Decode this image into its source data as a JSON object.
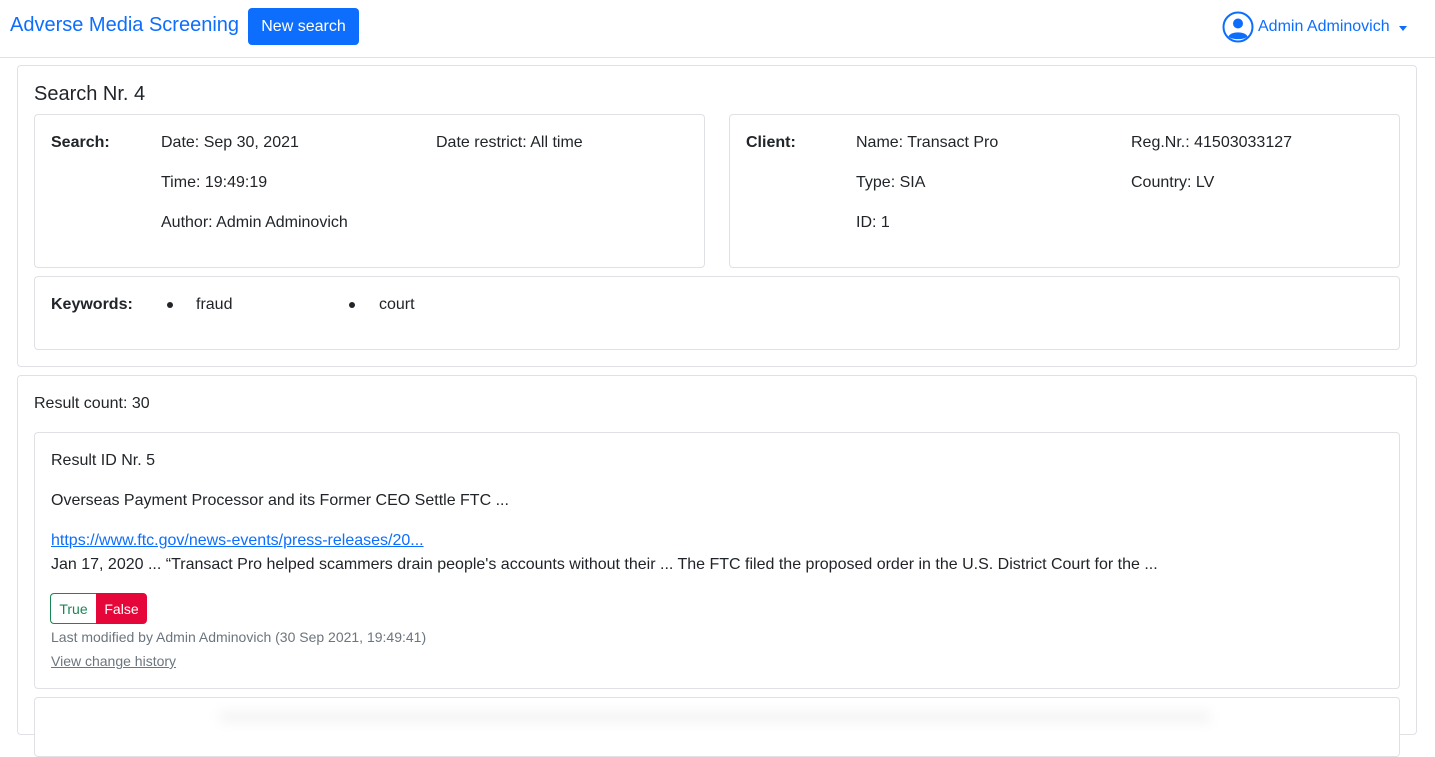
{
  "navbar": {
    "brand": "Adverse Media Screening",
    "new_search_label": "New search",
    "user_name": "Admin Adminovich",
    "user_icon": "user-circle-icon"
  },
  "search_card": {
    "title": "Search Nr. 4",
    "search": {
      "label": "Search:",
      "date": "Date: Sep 30, 2021",
      "time": "Time: 19:49:19",
      "author": "Author: Admin Adminovich",
      "date_restrict": "Date restrict: All time"
    },
    "client": {
      "label": "Client:",
      "name": "Name: Transact Pro",
      "type": "Type: SIA",
      "id": "ID: 1",
      "reg_nr": "Reg.Nr.: 41503033127",
      "country": "Country: LV"
    },
    "keywords": {
      "label": "Keywords:",
      "items": [
        "fraud",
        "court"
      ]
    }
  },
  "results": {
    "count_text": "Result count: 30",
    "items": [
      {
        "id_text": "Result ID Nr. 5",
        "title": "Overseas Payment Processor and its Former CEO Settle FTC ...",
        "url": "https://www.ftc.gov/news-events/press-releases/20...",
        "snippet": "Jan 17, 2020 ... “Transact Pro helped scammers drain people's accounts without their ... The FTC filed the proposed order in the U.S. District Court for the ...",
        "true_label": "True",
        "false_label": "False",
        "selected": "False",
        "modified": "Last modified by Admin Adminovich (30 Sep 2021, 19:49:41)",
        "history_link": "View change history"
      }
    ]
  },
  "colors": {
    "primary": "#0d6efd",
    "success": "#198754",
    "danger": "#e6073a",
    "border": "#dfe1e5",
    "muted": "#6c757d"
  }
}
